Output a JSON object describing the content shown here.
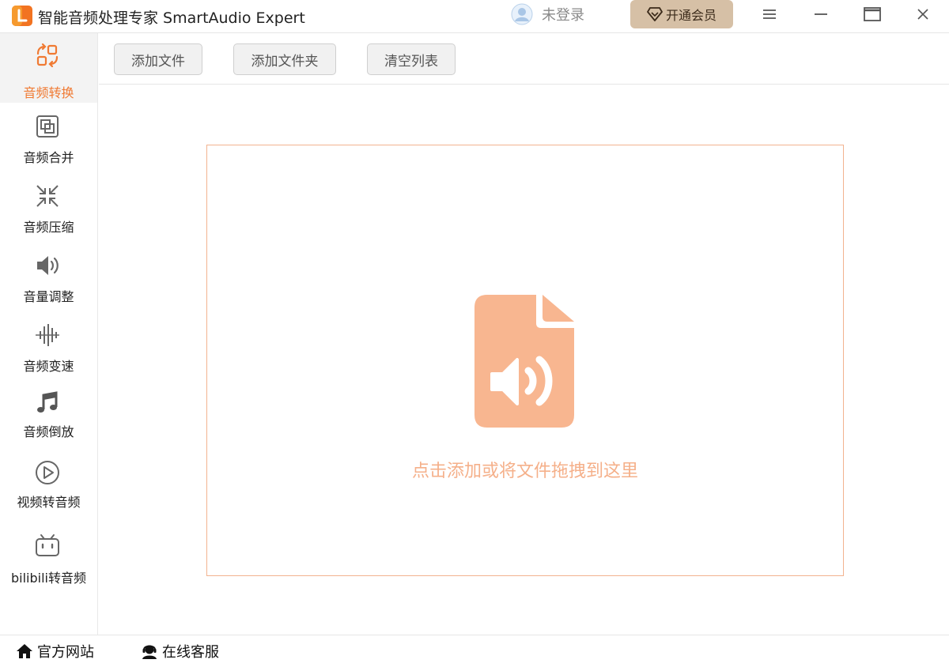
{
  "app": {
    "title": "智能音频处理专家 SmartAudio Expert"
  },
  "header": {
    "login_text": "未登录",
    "vip_label": "开通会员"
  },
  "colors": {
    "accent": "#f07a33",
    "dropzone_border": "#f2b38f",
    "file_icon": "#f8b690",
    "hint_text": "#f5b08a",
    "vip_bg": "#d6c0a6"
  },
  "sidebar": {
    "items": [
      {
        "label": "音频转换",
        "icon": "refresh-convert-icon",
        "active": true
      },
      {
        "label": "音频合并",
        "icon": "merge-squares-icon",
        "active": false
      },
      {
        "label": "音频压缩",
        "icon": "compress-arrows-icon",
        "active": false
      },
      {
        "label": "音量调整",
        "icon": "speaker-volume-icon",
        "active": false
      },
      {
        "label": "音频变速",
        "icon": "waveform-icon",
        "active": false
      },
      {
        "label": "音频倒放",
        "icon": "music-note-icon",
        "active": false
      },
      {
        "label": "视频转音频",
        "icon": "play-circle-icon",
        "active": false
      },
      {
        "label": "bilibili转音频",
        "icon": "bilibili-tv-icon",
        "active": false
      }
    ]
  },
  "toolbar": {
    "add_file": "添加文件",
    "add_folder": "添加文件夹",
    "clear_list": "清空列表"
  },
  "dropzone": {
    "hint": "点击添加或将文件拖拽到这里"
  },
  "statusbar": {
    "website": "官方网站",
    "support": "在线客服"
  }
}
